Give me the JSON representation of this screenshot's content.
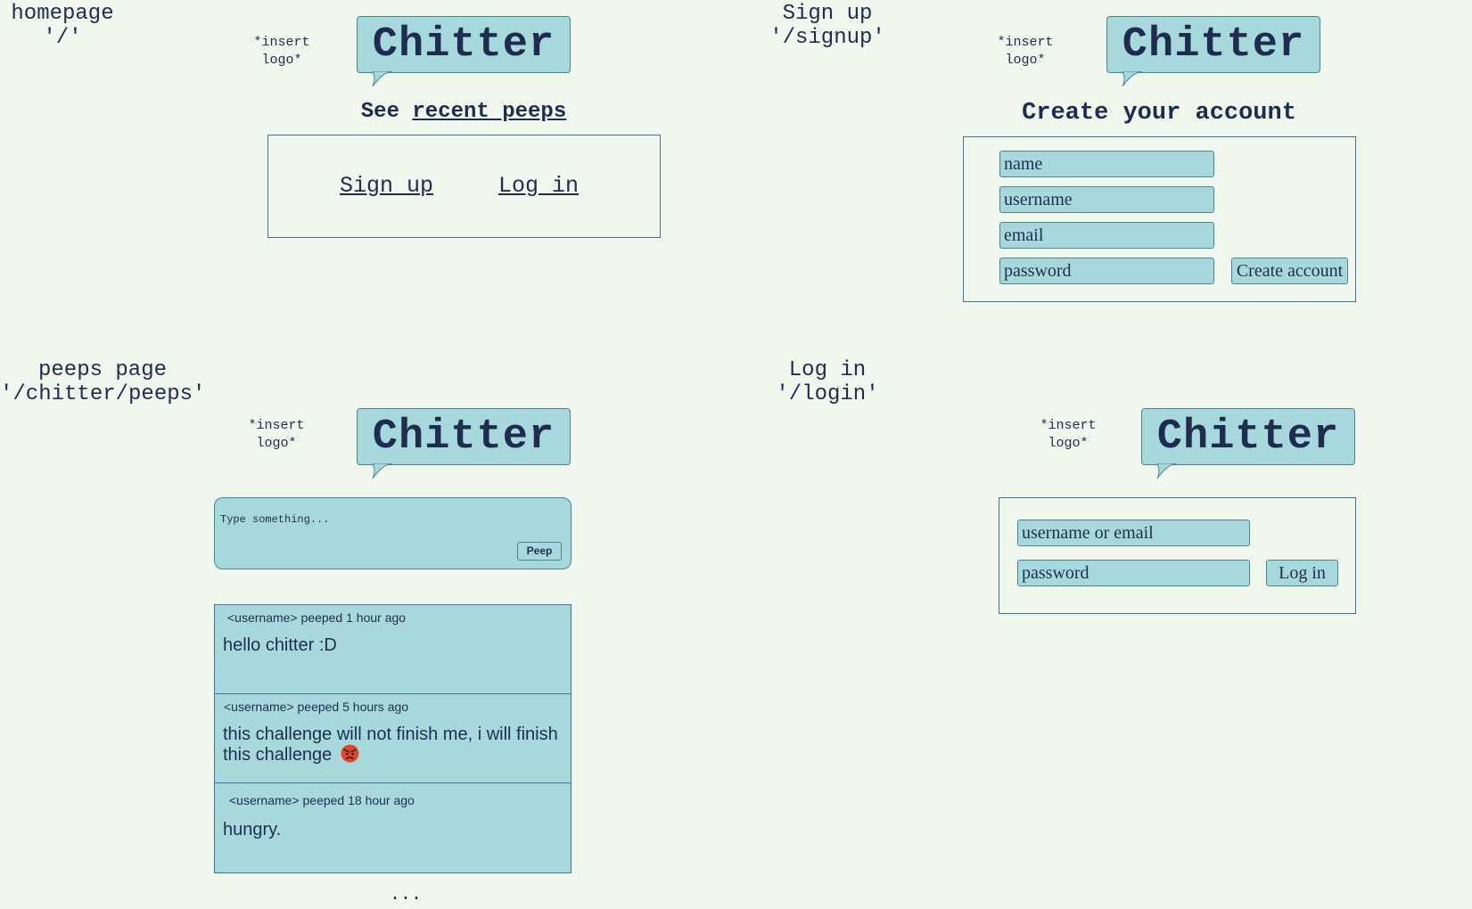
{
  "homepage": {
    "caption": [
      "homepage",
      "'/'"
    ],
    "logo_note": [
      "*insert",
      "logo*"
    ],
    "brand": "Chitter",
    "heading_prefix": "See",
    "heading_link": "recent peeps",
    "signup_link": "Sign up",
    "login_link": "Log in"
  },
  "signup": {
    "caption": [
      "Sign up",
      "'/signup'"
    ],
    "logo_note": [
      "*insert",
      "logo*"
    ],
    "brand": "Chitter",
    "heading": "Create your account",
    "fields": [
      "name",
      "username",
      "email",
      "password"
    ],
    "submit_label": "Create account"
  },
  "peeps_page": {
    "caption": [
      "peeps page",
      "'/chitter/peeps'"
    ],
    "logo_note": [
      "*insert",
      "logo*"
    ],
    "brand": "Chitter",
    "compose_placeholder": "Type something...",
    "peep_button": "Peep",
    "peeps": [
      {
        "meta": "<username> peeped 1 hour ago",
        "body": "hello chitter :D"
      },
      {
        "meta": "<username> peeped 5 hours ago",
        "body": "this challenge will not finish me, i will finish this challenge",
        "emoji": "angry-face"
      },
      {
        "meta": "<username> peeped 18 hour ago",
        "body": "hungry."
      }
    ],
    "ellipsis": "..."
  },
  "login": {
    "caption": [
      "Log in",
      "'/login'"
    ],
    "logo_note": [
      "*insert",
      "logo*"
    ],
    "brand": "Chitter",
    "fields": [
      "username or email",
      "password"
    ],
    "submit_label": "Log in"
  },
  "colors": {
    "background": "#f0f8ee",
    "bubble": "#a7d9dc",
    "text": "#1e2d4f",
    "border": "#4a7296"
  }
}
